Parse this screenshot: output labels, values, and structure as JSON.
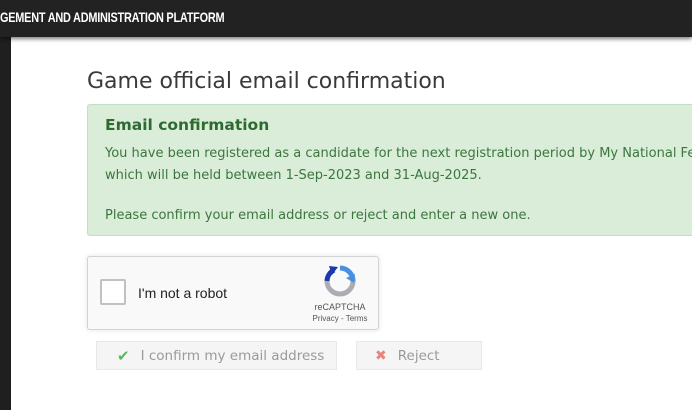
{
  "app": {
    "header_title": "GEMENT AND ADMINISTRATION PLATFORM"
  },
  "page": {
    "title": "Game official email confirmation"
  },
  "alert": {
    "heading": "Email confirmation",
    "line1": "You have been registered as a candidate for the next registration period by My National Feder",
    "line2": "which will be held between 1-Sep-2023 and 31-Aug-2025.",
    "line3": "Please confirm your email address or reject and enter a new one."
  },
  "captcha": {
    "label": "I'm not a robot",
    "brand": "reCAPTCHA",
    "privacy": "Privacy",
    "separator": " - ",
    "terms": "Terms",
    "logo_colors": {
      "blue": "#4a90e2",
      "dark_blue": "#1c3aa9",
      "gray": "#abadb3"
    }
  },
  "actions": {
    "confirm_label": "I confirm my email address",
    "confirm_icon": "check-icon",
    "reject_label": "Reject",
    "reject_icon": "x-icon"
  },
  "colors": {
    "alert_bg": "#d9edd9",
    "alert_text": "#3c763d",
    "success": "#5cb85c",
    "danger": "#e8857e"
  }
}
